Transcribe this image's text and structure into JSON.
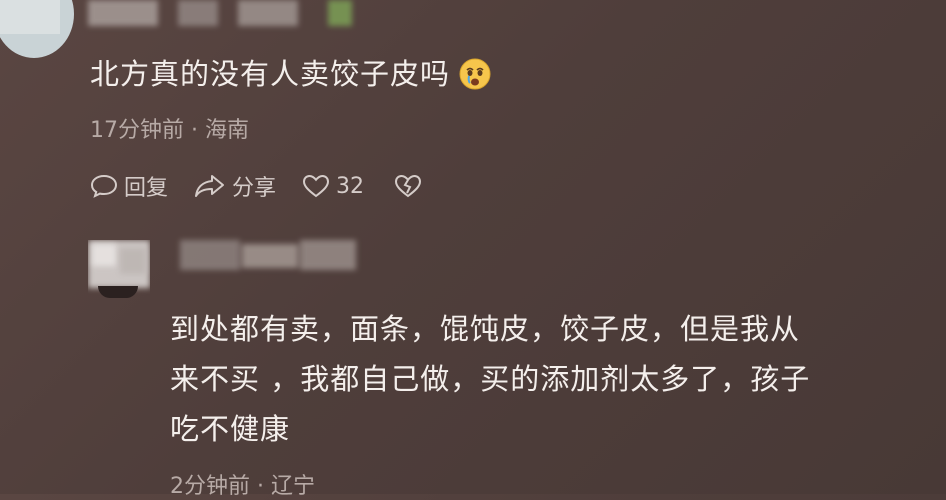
{
  "comment1": {
    "text": "北方真的没有人卖饺子皮吗",
    "emoji_icon": "crying-face-icon",
    "meta": "17分钟前 · 海南",
    "actions": {
      "reply_label": "回复",
      "share_label": "分享",
      "like_count": "32"
    }
  },
  "comment2": {
    "text_line1": "到处都有卖，面条，馄饨皮，饺子皮，但是我从",
    "text_line2": "来不买 ，我都自己做，买的添加剂太多了，孩子",
    "text_line3": "吃不健康",
    "meta": "2分钟前 · 辽宁"
  },
  "colors": {
    "background": "#503f3c",
    "text": "#f2ece9",
    "meta": "#b7aaa6"
  }
}
